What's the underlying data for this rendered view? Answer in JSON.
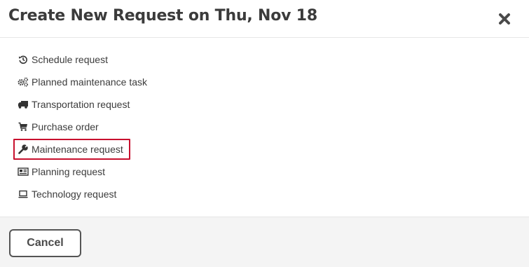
{
  "dialog": {
    "title": "Create New Request on Thu, Nov 18",
    "close_icon": "close-icon"
  },
  "options": [
    {
      "label": "Schedule request",
      "icon": "history-icon"
    },
    {
      "label": "Planned maintenance task",
      "icon": "gears-icon"
    },
    {
      "label": "Transportation request",
      "icon": "truck-icon"
    },
    {
      "label": "Purchase order",
      "icon": "shopping-cart-icon"
    },
    {
      "label": "Maintenance request",
      "icon": "wrench-icon",
      "highlighted": true
    },
    {
      "label": "Planning request",
      "icon": "newspaper-icon"
    },
    {
      "label": "Technology request",
      "icon": "laptop-icon"
    }
  ],
  "footer": {
    "cancel_label": "Cancel"
  },
  "colors": {
    "highlight_border": "#c8102e",
    "text": "#3c3c3c",
    "footer_bg": "#f4f4f4"
  }
}
